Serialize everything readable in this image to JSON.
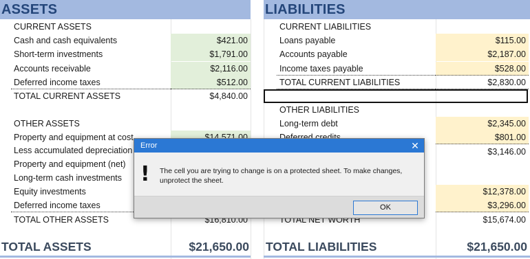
{
  "assets": {
    "header": "ASSETS",
    "current_title": "CURRENT ASSETS",
    "current_rows": [
      {
        "label": "Cash and cash equivalents",
        "value": "$421.00"
      },
      {
        "label": "Short-term investments",
        "value": "$1,791.00"
      },
      {
        "label": "Accounts receivable",
        "value": "$2,116.00"
      },
      {
        "label": "Deferred income taxes",
        "value": "$512.00"
      }
    ],
    "total_current": {
      "label": "TOTAL CURRENT ASSETS",
      "value": "$4,840.00"
    },
    "other_title": "OTHER ASSETS",
    "other_rows": [
      {
        "label": "Property and equipment at cost",
        "value": "$14,571.00"
      },
      {
        "label": "Less accumulated depreciation",
        "value": ""
      },
      {
        "label": "Property and equipment (net)",
        "value": ""
      },
      {
        "label": "Long-term cash investments",
        "value": ""
      },
      {
        "label": "Equity investments",
        "value": ""
      },
      {
        "label": "Deferred income taxes",
        "value": ""
      }
    ],
    "total_other": {
      "label": "TOTAL OTHER ASSETS",
      "value": "$16,810.00"
    },
    "grand_total": {
      "label": "TOTAL ASSETS",
      "value": "$21,650.00"
    }
  },
  "liabilities": {
    "header": "LIABILITIES",
    "current_title": "CURRENT LIABILITIES",
    "current_rows": [
      {
        "label": "Loans payable",
        "value": "$115.00"
      },
      {
        "label": "Accounts payable",
        "value": "$2,187.00"
      },
      {
        "label": "Income taxes payable",
        "value": "$528.00"
      }
    ],
    "total_current": {
      "label": "TOTAL CURRENT LIABILITIES",
      "value": "$2,830.00"
    },
    "other_title": "OTHER LIABILITIES",
    "other_rows": [
      {
        "label": "Long-term debt",
        "value": "$2,345.00"
      },
      {
        "label": "Deferred credits",
        "value": "$801.00"
      },
      {
        "label": "",
        "value": "$3,146.00"
      }
    ],
    "equity_rows": [
      {
        "label": "",
        "value": "$12,378.00"
      },
      {
        "label": "",
        "value": "$3,296.00"
      }
    ],
    "total_net_worth": {
      "label": "TOTAL NET WORTH",
      "value": "$15,674.00"
    },
    "grand_total": {
      "label": "TOTAL LIABILITIES",
      "value": "$21,650.00"
    }
  },
  "dialog": {
    "title": "Error",
    "close_glyph": "✕",
    "icon_glyph": "!",
    "message": "The cell you are trying to change is on a protected sheet. To make changes, unprotect the sheet.",
    "ok_label": "OK"
  },
  "colors": {
    "header_bg": "#a3b9e0",
    "header_text": "#24467a",
    "input_green": "#e2efda",
    "input_yellow": "#fff2cc",
    "dialog_titlebar": "#2b78d4"
  }
}
